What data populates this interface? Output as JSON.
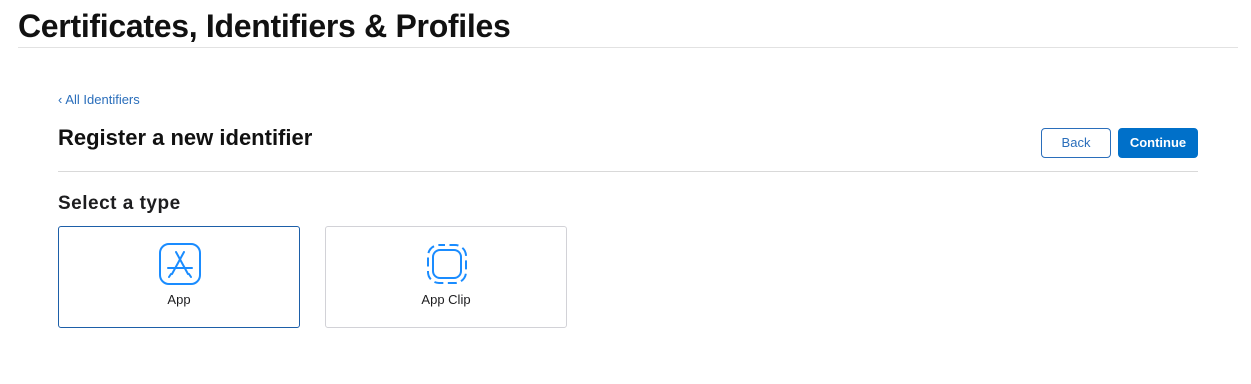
{
  "header": {
    "title": "Certificates, Identifiers & Profiles"
  },
  "nav": {
    "back_link": "All Identifiers"
  },
  "main": {
    "title": "Register a new identifier",
    "back_button": "Back",
    "continue_button": "Continue",
    "select_type_title": "Select a type",
    "types": [
      {
        "label": "App",
        "icon": "app-store-icon",
        "selected": true
      },
      {
        "label": "App Clip",
        "icon": "app-clip-icon",
        "selected": false
      }
    ]
  },
  "colors": {
    "accent": "#0070c9",
    "link": "#2a6ebb",
    "icon": "#1a8cff"
  }
}
